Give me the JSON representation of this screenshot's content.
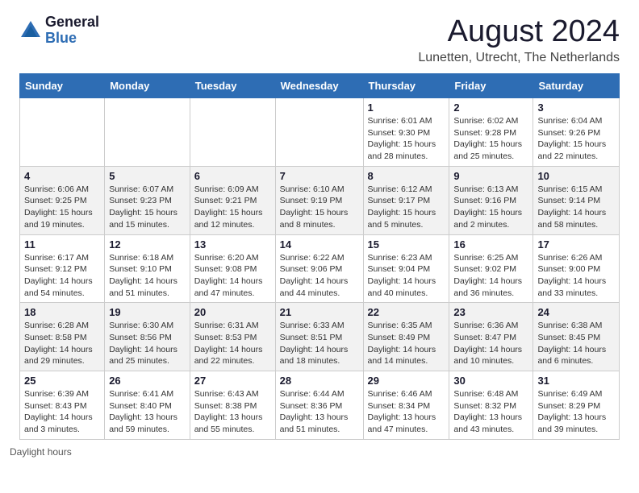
{
  "logo": {
    "general": "General",
    "blue": "Blue"
  },
  "title": "August 2024",
  "subtitle": "Lunetten, Utrecht, The Netherlands",
  "days": [
    "Sunday",
    "Monday",
    "Tuesday",
    "Wednesday",
    "Thursday",
    "Friday",
    "Saturday"
  ],
  "weeks": [
    [
      {
        "num": "",
        "info": ""
      },
      {
        "num": "",
        "info": ""
      },
      {
        "num": "",
        "info": ""
      },
      {
        "num": "",
        "info": ""
      },
      {
        "num": "1",
        "info": "Sunrise: 6:01 AM\nSunset: 9:30 PM\nDaylight: 15 hours and 28 minutes."
      },
      {
        "num": "2",
        "info": "Sunrise: 6:02 AM\nSunset: 9:28 PM\nDaylight: 15 hours and 25 minutes."
      },
      {
        "num": "3",
        "info": "Sunrise: 6:04 AM\nSunset: 9:26 PM\nDaylight: 15 hours and 22 minutes."
      }
    ],
    [
      {
        "num": "4",
        "info": "Sunrise: 6:06 AM\nSunset: 9:25 PM\nDaylight: 15 hours and 19 minutes."
      },
      {
        "num": "5",
        "info": "Sunrise: 6:07 AM\nSunset: 9:23 PM\nDaylight: 15 hours and 15 minutes."
      },
      {
        "num": "6",
        "info": "Sunrise: 6:09 AM\nSunset: 9:21 PM\nDaylight: 15 hours and 12 minutes."
      },
      {
        "num": "7",
        "info": "Sunrise: 6:10 AM\nSunset: 9:19 PM\nDaylight: 15 hours and 8 minutes."
      },
      {
        "num": "8",
        "info": "Sunrise: 6:12 AM\nSunset: 9:17 PM\nDaylight: 15 hours and 5 minutes."
      },
      {
        "num": "9",
        "info": "Sunrise: 6:13 AM\nSunset: 9:16 PM\nDaylight: 15 hours and 2 minutes."
      },
      {
        "num": "10",
        "info": "Sunrise: 6:15 AM\nSunset: 9:14 PM\nDaylight: 14 hours and 58 minutes."
      }
    ],
    [
      {
        "num": "11",
        "info": "Sunrise: 6:17 AM\nSunset: 9:12 PM\nDaylight: 14 hours and 54 minutes."
      },
      {
        "num": "12",
        "info": "Sunrise: 6:18 AM\nSunset: 9:10 PM\nDaylight: 14 hours and 51 minutes."
      },
      {
        "num": "13",
        "info": "Sunrise: 6:20 AM\nSunset: 9:08 PM\nDaylight: 14 hours and 47 minutes."
      },
      {
        "num": "14",
        "info": "Sunrise: 6:22 AM\nSunset: 9:06 PM\nDaylight: 14 hours and 44 minutes."
      },
      {
        "num": "15",
        "info": "Sunrise: 6:23 AM\nSunset: 9:04 PM\nDaylight: 14 hours and 40 minutes."
      },
      {
        "num": "16",
        "info": "Sunrise: 6:25 AM\nSunset: 9:02 PM\nDaylight: 14 hours and 36 minutes."
      },
      {
        "num": "17",
        "info": "Sunrise: 6:26 AM\nSunset: 9:00 PM\nDaylight: 14 hours and 33 minutes."
      }
    ],
    [
      {
        "num": "18",
        "info": "Sunrise: 6:28 AM\nSunset: 8:58 PM\nDaylight: 14 hours and 29 minutes."
      },
      {
        "num": "19",
        "info": "Sunrise: 6:30 AM\nSunset: 8:56 PM\nDaylight: 14 hours and 25 minutes."
      },
      {
        "num": "20",
        "info": "Sunrise: 6:31 AM\nSunset: 8:53 PM\nDaylight: 14 hours and 22 minutes."
      },
      {
        "num": "21",
        "info": "Sunrise: 6:33 AM\nSunset: 8:51 PM\nDaylight: 14 hours and 18 minutes."
      },
      {
        "num": "22",
        "info": "Sunrise: 6:35 AM\nSunset: 8:49 PM\nDaylight: 14 hours and 14 minutes."
      },
      {
        "num": "23",
        "info": "Sunrise: 6:36 AM\nSunset: 8:47 PM\nDaylight: 14 hours and 10 minutes."
      },
      {
        "num": "24",
        "info": "Sunrise: 6:38 AM\nSunset: 8:45 PM\nDaylight: 14 hours and 6 minutes."
      }
    ],
    [
      {
        "num": "25",
        "info": "Sunrise: 6:39 AM\nSunset: 8:43 PM\nDaylight: 14 hours and 3 minutes."
      },
      {
        "num": "26",
        "info": "Sunrise: 6:41 AM\nSunset: 8:40 PM\nDaylight: 13 hours and 59 minutes."
      },
      {
        "num": "27",
        "info": "Sunrise: 6:43 AM\nSunset: 8:38 PM\nDaylight: 13 hours and 55 minutes."
      },
      {
        "num": "28",
        "info": "Sunrise: 6:44 AM\nSunset: 8:36 PM\nDaylight: 13 hours and 51 minutes."
      },
      {
        "num": "29",
        "info": "Sunrise: 6:46 AM\nSunset: 8:34 PM\nDaylight: 13 hours and 47 minutes."
      },
      {
        "num": "30",
        "info": "Sunrise: 6:48 AM\nSunset: 8:32 PM\nDaylight: 13 hours and 43 minutes."
      },
      {
        "num": "31",
        "info": "Sunrise: 6:49 AM\nSunset: 8:29 PM\nDaylight: 13 hours and 39 minutes."
      }
    ]
  ],
  "footer": "Daylight hours"
}
